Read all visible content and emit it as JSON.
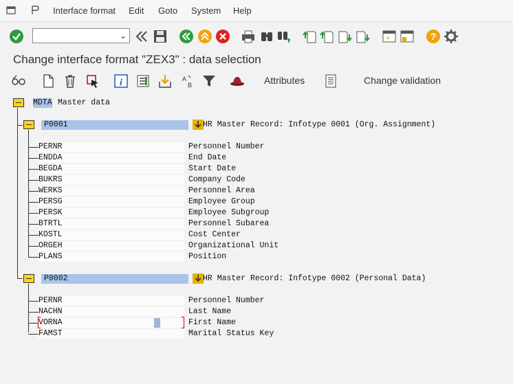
{
  "menubar": {
    "items": [
      "Interface format",
      "Edit",
      "Goto",
      "System",
      "Help"
    ]
  },
  "toolbar": {
    "command_field_value": "",
    "icons": [
      "enter-icon",
      "back-icon",
      "save-icon",
      "back-nav-icon",
      "exit-icon",
      "cancel-icon",
      "print-icon",
      "find-icon",
      "find-next-icon",
      "first-page-icon",
      "previous-page-icon",
      "next-page-icon",
      "last-page-icon",
      "new-session-icon",
      "shortcut-icon",
      "help-icon",
      "settings-icon"
    ]
  },
  "title": "Change interface format \"ZEX3\" : data selection",
  "app_toolbar": {
    "attributes_label": "Attributes",
    "change_validation_label": "Change validation"
  },
  "tree": {
    "root": {
      "code": "MDTA",
      "label": "Master data"
    },
    "infotypes": [
      {
        "code": "P0001",
        "description": "HR Master Record: Infotype 0001 (Org. Assignment)",
        "fields": [
          {
            "name": "PERNR",
            "desc": "Personnel Number"
          },
          {
            "name": "ENDDA",
            "desc": "End Date"
          },
          {
            "name": "BEGDA",
            "desc": "Start Date"
          },
          {
            "name": "BUKRS",
            "desc": "Company Code"
          },
          {
            "name": "WERKS",
            "desc": "Personnel Area"
          },
          {
            "name": "PERSG",
            "desc": "Employee Group"
          },
          {
            "name": "PERSK",
            "desc": "Employee Subgroup"
          },
          {
            "name": "BTRTL",
            "desc": "Personnel Subarea"
          },
          {
            "name": "KOSTL",
            "desc": "Cost Center"
          },
          {
            "name": "ORGEH",
            "desc": "Organizational Unit"
          },
          {
            "name": "PLANS",
            "desc": "Position"
          }
        ]
      },
      {
        "code": "P0002",
        "description": "HR Master Record: Infotype 0002 (Personal Data)",
        "fields": [
          {
            "name": "PERNR",
            "desc": "Personnel Number"
          },
          {
            "name": "NACHN",
            "desc": "Last Name"
          },
          {
            "name": "VORNA",
            "desc": "First Name"
          },
          {
            "name": "FAMST",
            "desc": "Marital Status Key"
          }
        ]
      }
    ]
  }
}
